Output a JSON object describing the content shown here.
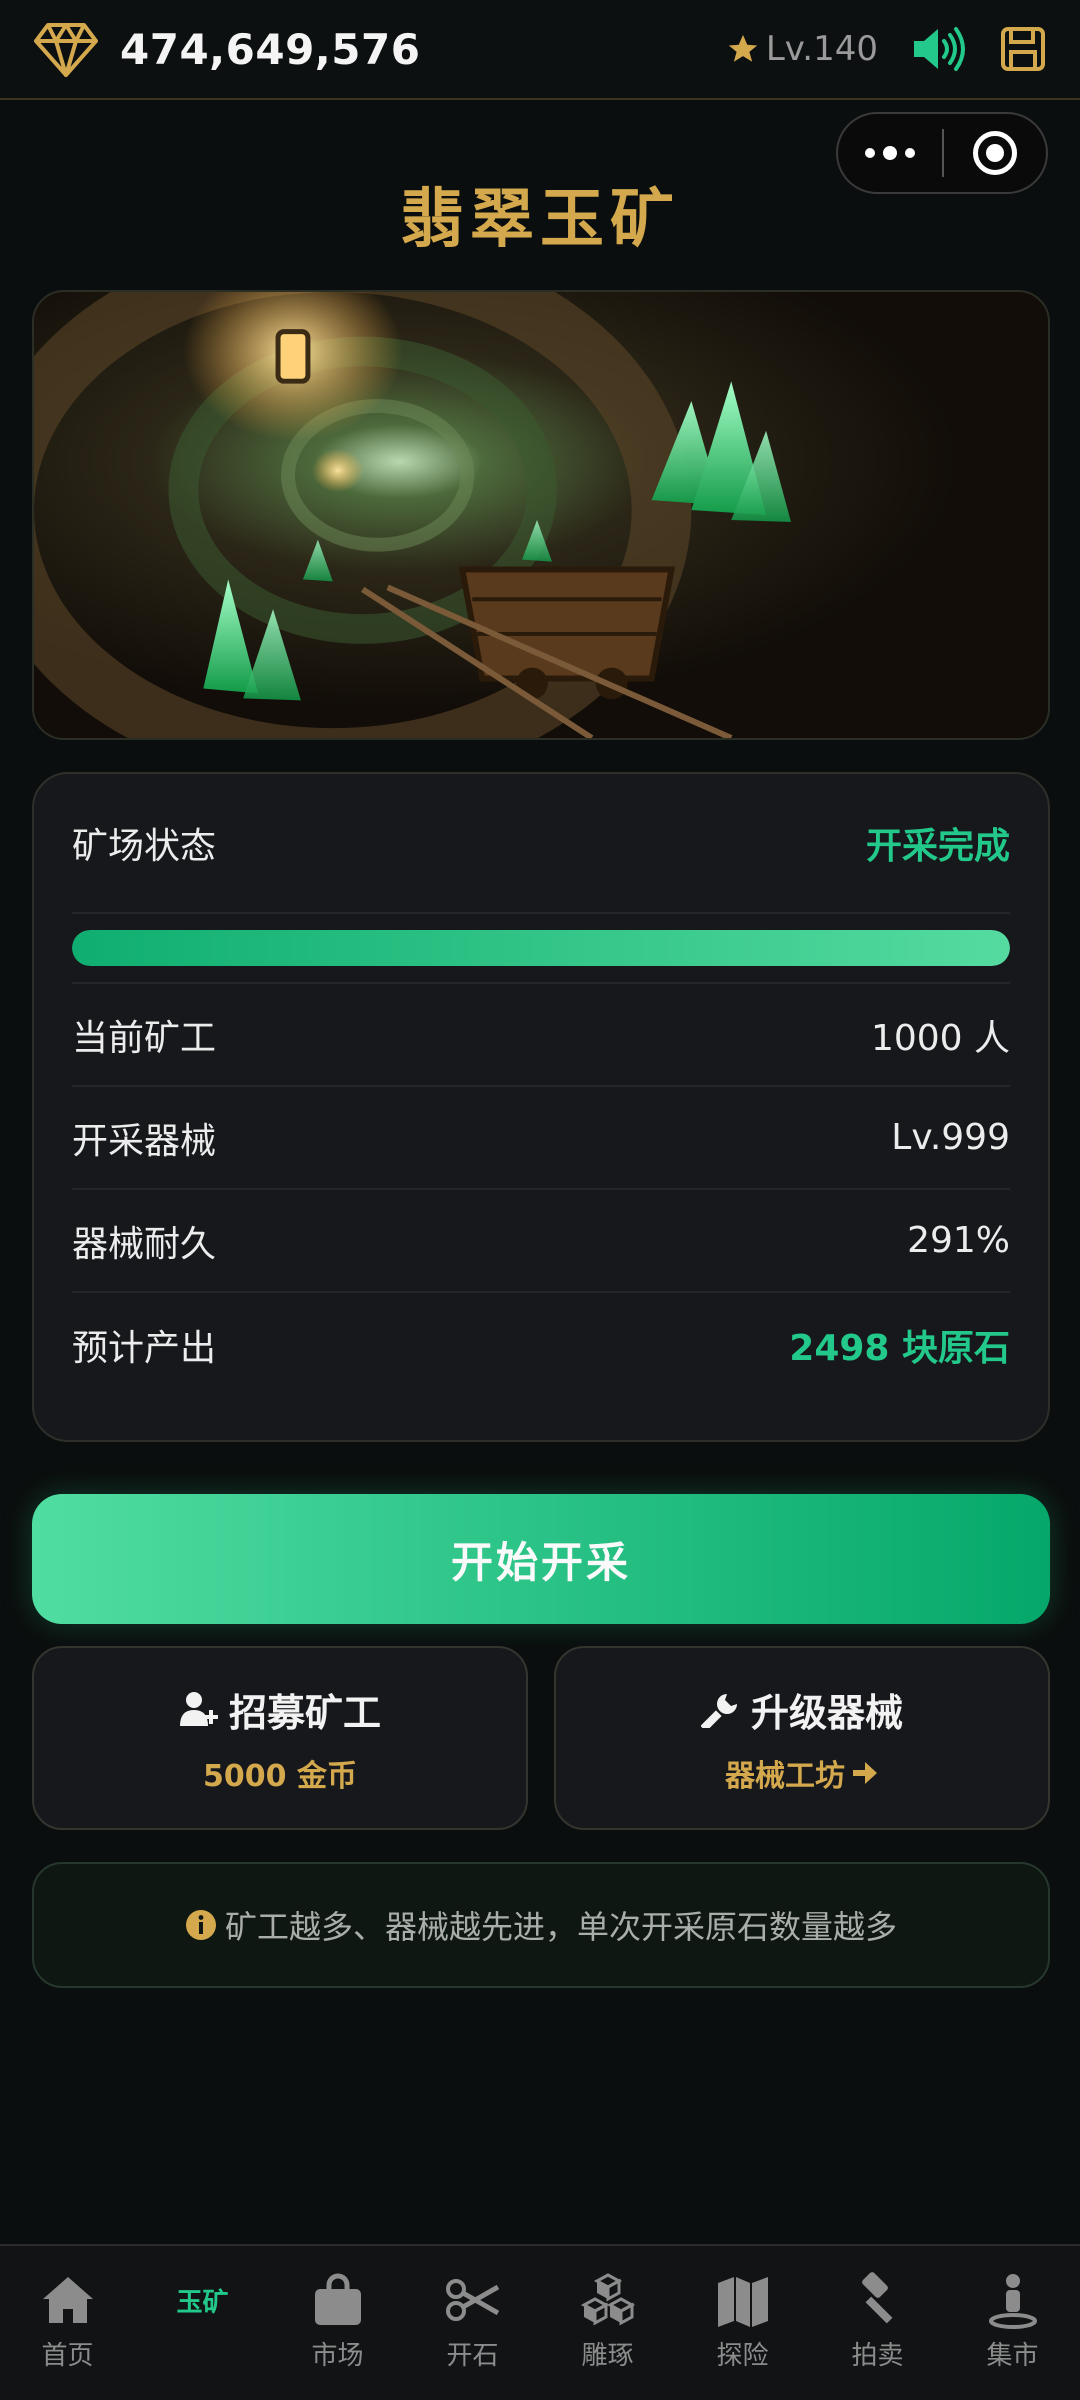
{
  "topbar": {
    "coins": "474,649,576",
    "level": "Lv.140",
    "icons": [
      "diamond-icon",
      "star-icon",
      "volume-icon",
      "save-icon"
    ],
    "colors": {
      "gold": "#d4a84c",
      "green": "#22c98a"
    }
  },
  "capsule": {
    "icons": [
      "more-dots-icon",
      "target-icon"
    ]
  },
  "page": {
    "title": "翡翠玉矿"
  },
  "status": {
    "state_label": "矿场状态",
    "state_value": "开采完成",
    "progress": 1.0,
    "rows": [
      {
        "label": "当前矿工",
        "value": "1000 人"
      },
      {
        "label": "开采器械",
        "value": "Lv.999"
      },
      {
        "label": "器械耐久",
        "value": "291%"
      },
      {
        "label": "预计产出",
        "value": "2498 块原石"
      }
    ]
  },
  "start_button": {
    "label": "开始开采"
  },
  "actions": {
    "recruit": {
      "title": "招募矿工",
      "sub": "5000 金币",
      "icon": "user-plus-icon"
    },
    "upgrade": {
      "title": "升级器械",
      "sub": "器械工坊",
      "icon": "wrench-icon"
    }
  },
  "tip": {
    "text": "矿工越多、器械越先进，单次开采原石数量越多",
    "icon": "info-icon"
  },
  "nav": {
    "items": [
      {
        "label": "首页",
        "icon": "home-icon"
      },
      {
        "label": "玉矿",
        "icon": "mine-icon"
      },
      {
        "label": "市场",
        "icon": "shopping-bag-icon"
      },
      {
        "label": "开石",
        "icon": "scissors-icon"
      },
      {
        "label": "雕琢",
        "icon": "cubes-icon"
      },
      {
        "label": "探险",
        "icon": "map-icon"
      },
      {
        "label": "拍卖",
        "icon": "gavel-icon"
      },
      {
        "label": "集市",
        "icon": "person-icon"
      }
    ]
  }
}
